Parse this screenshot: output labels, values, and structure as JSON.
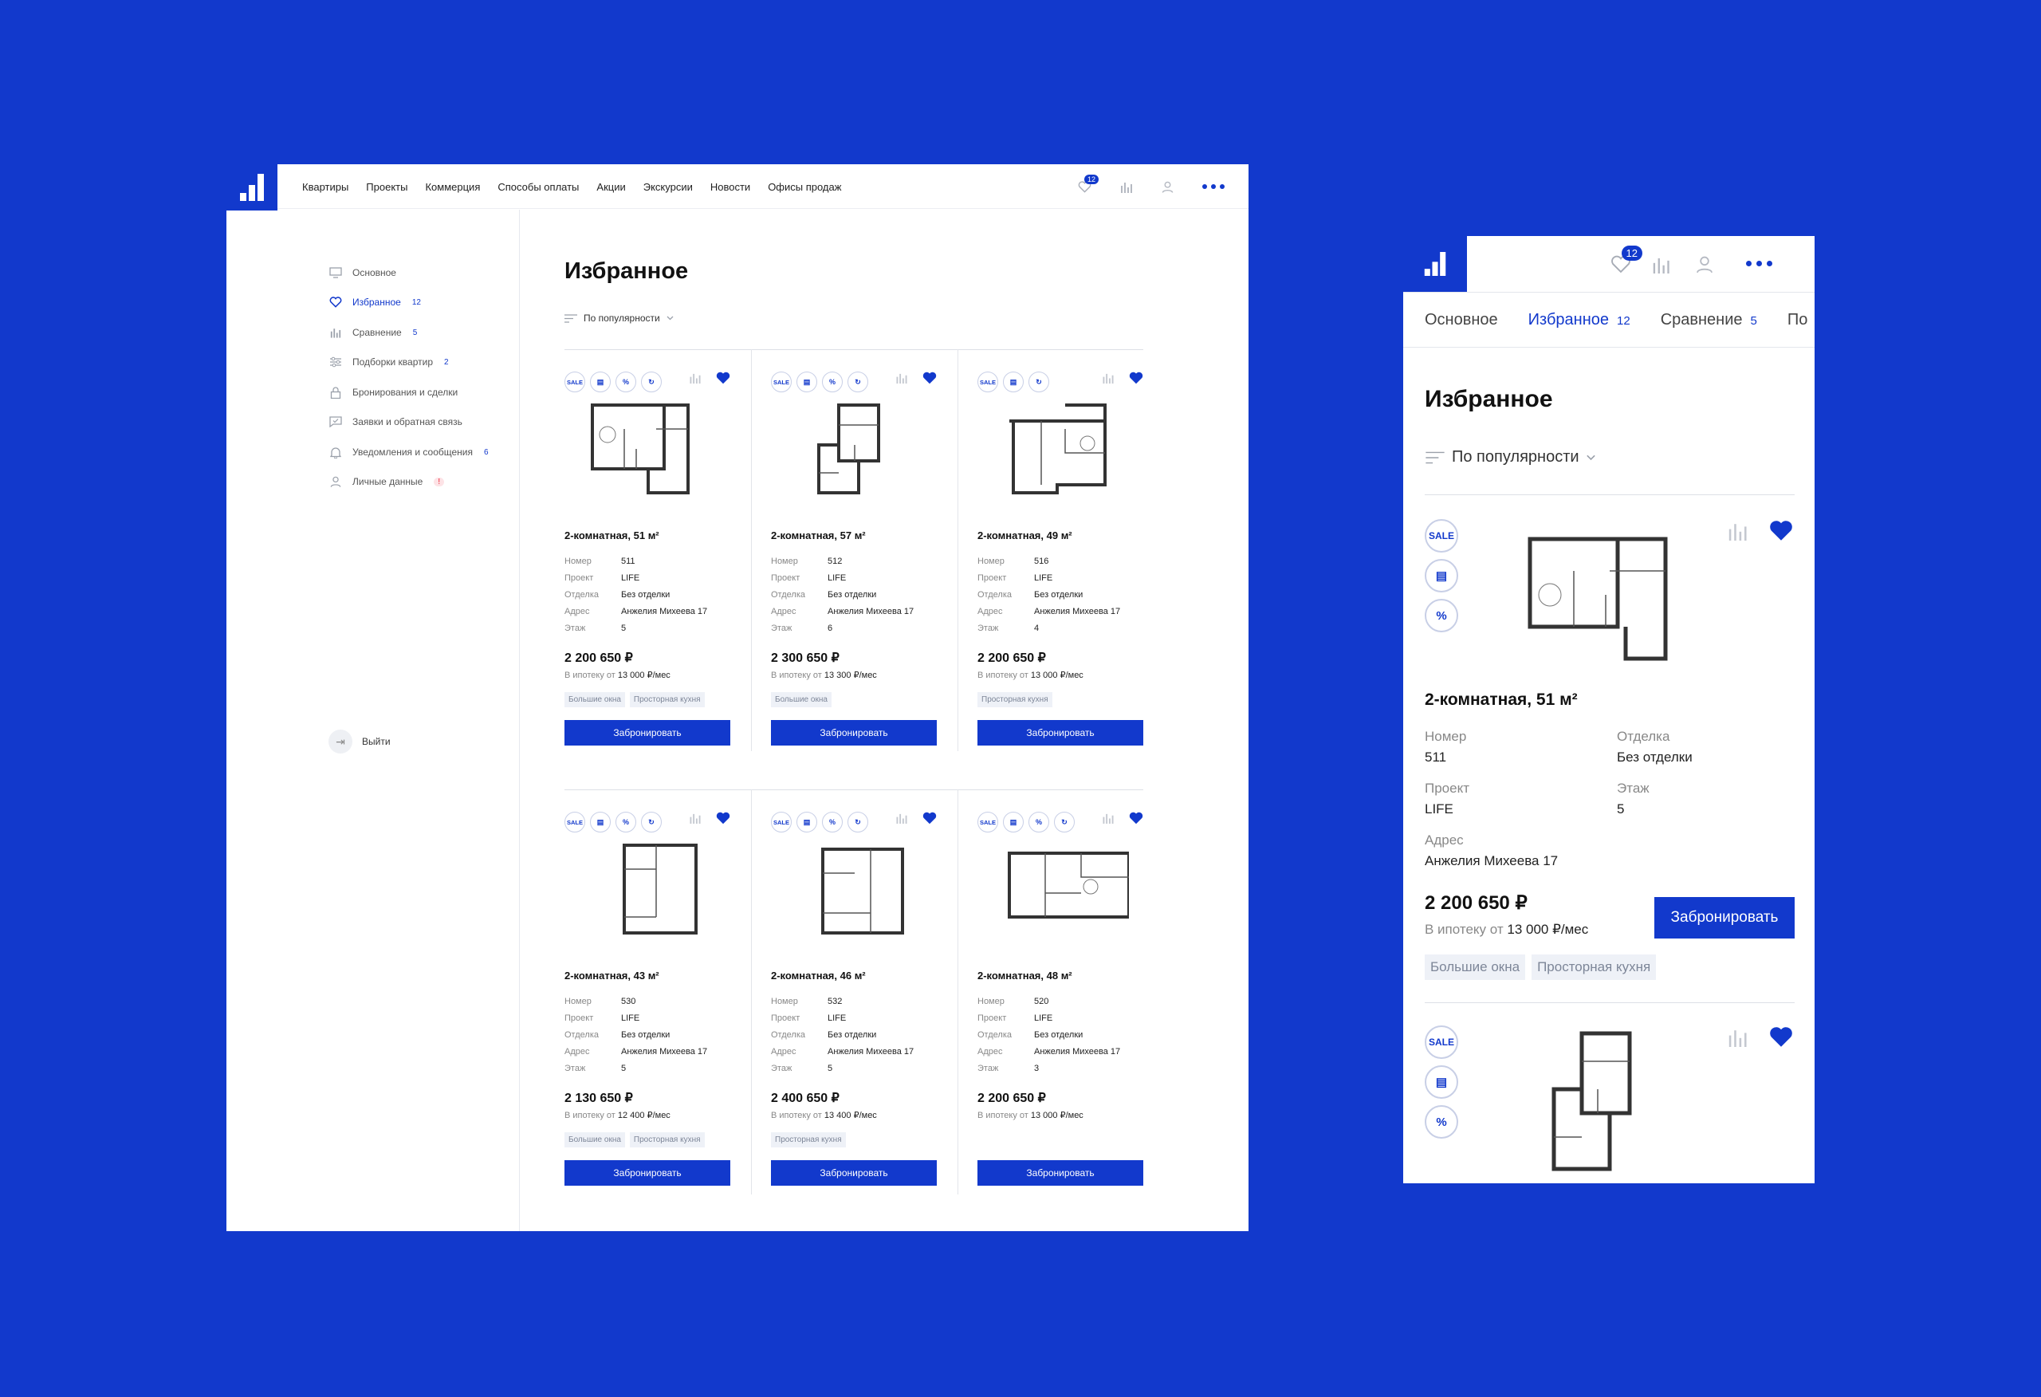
{
  "brand": {
    "accent": "#1239cc",
    "background": "#1239cc"
  },
  "nav": [
    "Квартиры",
    "Проекты",
    "Коммерция",
    "Способы оплаты",
    "Акции",
    "Экскурсии",
    "Новости",
    "Офисы продаж"
  ],
  "header": {
    "favorites_count": "12"
  },
  "sidebar": {
    "items": [
      {
        "label": "Основное",
        "icon": "monitor-icon",
        "count": ""
      },
      {
        "label": "Избранное",
        "icon": "heart-icon",
        "count": "12"
      },
      {
        "label": "Сравнение",
        "icon": "chart-icon",
        "count": "5"
      },
      {
        "label": "Подборки квартир",
        "icon": "sliders-icon",
        "count": "2"
      },
      {
        "label": "Бронирования и сделки",
        "icon": "lock-icon",
        "count": ""
      },
      {
        "label": "Заявки и обратная связь",
        "icon": "message-icon",
        "count": ""
      },
      {
        "label": "Уведомления и сообщения",
        "icon": "bell-icon",
        "count": "6"
      },
      {
        "label": "Личные данные",
        "icon": "user-icon",
        "count": "!"
      }
    ],
    "logout": "Выйти"
  },
  "page": {
    "title": "Избранное",
    "sort": "По популярности"
  },
  "labels": {
    "number": "Номер",
    "project": "Проект",
    "finish": "Отделка",
    "address": "Адрес",
    "floor": "Этаж",
    "mortgage_prefix": "В ипотеку от",
    "book": "Забронировать",
    "sale": "SALE"
  },
  "cards": [
    {
      "title": "2-комнатная, 51 м²",
      "number": "511",
      "project": "LIFE",
      "finish": "Без отделки",
      "address": "Анжелия Михеева 17",
      "floor": "5",
      "price": "2 200 650 ₽",
      "mortgage": "13 000 ₽/мес",
      "tags": [
        "Большие окна",
        "Просторная кухня"
      ]
    },
    {
      "title": "2-комнатная, 57 м²",
      "number": "512",
      "project": "LIFE",
      "finish": "Без отделки",
      "address": "Анжелия Михеева 17",
      "floor": "6",
      "price": "2 300 650 ₽",
      "mortgage": "13 300 ₽/мес",
      "tags": [
        "Большие окна"
      ]
    },
    {
      "title": "2-комнатная, 49 м²",
      "number": "516",
      "project": "LIFE",
      "finish": "Без отделки",
      "address": "Анжелия Михеева 17",
      "floor": "4",
      "price": "2 200 650 ₽",
      "mortgage": "13 000 ₽/мес",
      "tags": [
        "Просторная кухня"
      ]
    },
    {
      "title": "2-комнатная, 43 м²",
      "number": "530",
      "project": "LIFE",
      "finish": "Без отделки",
      "address": "Анжелия Михеева 17",
      "floor": "5",
      "price": "2 130 650 ₽",
      "mortgage": "12 400 ₽/мес",
      "tags": [
        "Большие окна",
        "Просторная кухня"
      ]
    },
    {
      "title": "2-комнатная, 46 м²",
      "number": "532",
      "project": "LIFE",
      "finish": "Без отделки",
      "address": "Анжелия Михеева 17",
      "floor": "5",
      "price": "2 400 650 ₽",
      "mortgage": "13 400 ₽/мес",
      "tags": [
        "Просторная кухня"
      ]
    },
    {
      "title": "2-комнатная, 48 м²",
      "number": "520",
      "project": "LIFE",
      "finish": "Без отделки",
      "address": "Анжелия Михеева 17",
      "floor": "3",
      "price": "2 200 650 ₽",
      "mortgage": "13 000 ₽/мес",
      "tags": []
    }
  ],
  "mobile": {
    "tabs": [
      {
        "label": "Основное",
        "count": ""
      },
      {
        "label": "Избранное",
        "count": "12"
      },
      {
        "label": "Сравнение",
        "count": "5"
      },
      {
        "label": "По",
        "count": ""
      }
    ]
  }
}
